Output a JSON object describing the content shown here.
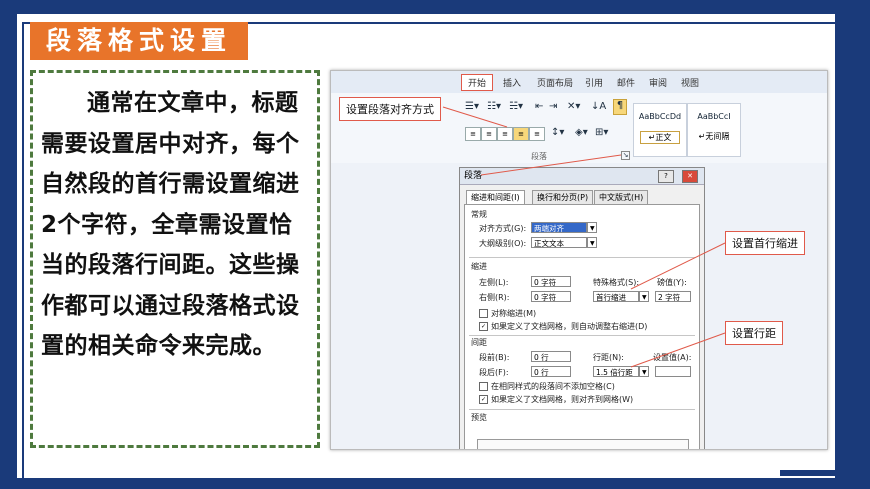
{
  "title": "段落格式设置",
  "body_text": "通常在文章中，标题需要设置居中对齐，每个自然段的首行需设置缩进2个字符，全章需设置恰当的段落行间距。这些操作都可以通过段落格式设置的相关命令来完成。",
  "screenshot": {
    "ribbon_tabs": [
      "开始",
      "插入",
      "页面布局",
      "引用",
      "邮件",
      "审阅",
      "视图"
    ],
    "styles": [
      {
        "sample": "AaBbCcDd",
        "name": "↵正文"
      },
      {
        "sample": "AaBbCcI",
        "name": "↵无间隔"
      }
    ],
    "group_label": "段落",
    "callouts": {
      "align": "设置段落对齐方式",
      "indent": "设置首行缩进",
      "spacing": "设置行距"
    },
    "dialog": {
      "title": "段落",
      "help_btn": "?",
      "close_btn": "✕",
      "tabs": [
        "缩进和间距(I)",
        "换行和分页(P)",
        "中文版式(H)"
      ],
      "general": {
        "heading": "常规",
        "align_label": "对齐方式(G):",
        "align_value": "两端对齐",
        "outline_label": "大纲级别(O):",
        "outline_value": "正文文本"
      },
      "indent": {
        "heading": "缩进",
        "left_label": "左侧(L):",
        "left_value": "0 字符",
        "right_label": "右侧(R):",
        "right_value": "0 字符",
        "special_label": "特殊格式(S):",
        "special_value": "首行缩进",
        "amount_label": "磅值(Y):",
        "amount_value": "2 字符",
        "mirror": "对称缩进(M)",
        "auto_adjust": "如果定义了文档网格，则自动调整右缩进(D)"
      },
      "spacing": {
        "heading": "间距",
        "before_label": "段前(B):",
        "before_value": "0 行",
        "after_label": "段后(F):",
        "after_value": "0 行",
        "line_label": "行距(N):",
        "line_value": "1.5 倍行距",
        "at_label": "设置值(A):",
        "no_space": "在相同样式的段落间不添加空格(C)",
        "snap_grid": "如果定义了文档网格，则对齐到网格(W)"
      },
      "preview_label": "预览"
    }
  }
}
